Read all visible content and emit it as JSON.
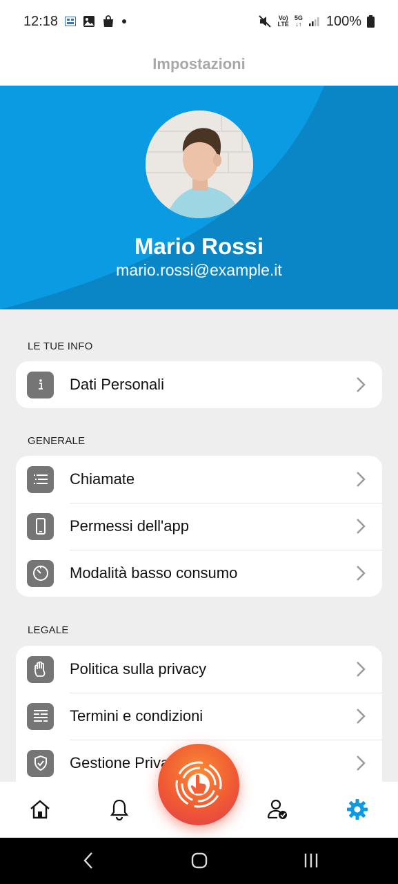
{
  "status_bar": {
    "time": "12:18",
    "battery": "100%",
    "icons": [
      "calendar-notification-icon",
      "image-icon",
      "shopping-bag-icon",
      "dot-icon",
      "mute-icon",
      "volte-icon",
      "5g-icon",
      "signal-icon",
      "battery-icon"
    ],
    "volte_label_top": "Vo)",
    "volte_label_bottom": "LTE",
    "net_label": "5G"
  },
  "header": {
    "title": "Impostazioni"
  },
  "profile": {
    "name": "Mario Rossi",
    "email": "mario.rossi@example.it"
  },
  "sections": [
    {
      "label": "LE TUE INFO",
      "items": [
        {
          "label": "Dati Personali",
          "icon": "info-icon"
        }
      ]
    },
    {
      "label": "GENERALE",
      "items": [
        {
          "label": "Chiamate",
          "icon": "list-icon"
        },
        {
          "label": "Permessi dell'app",
          "icon": "phone-icon"
        },
        {
          "label": "Modalità basso consumo",
          "icon": "timer-icon"
        }
      ]
    },
    {
      "label": "LEGALE",
      "items": [
        {
          "label": "Politica sulla privacy",
          "icon": "hand-icon"
        },
        {
          "label": "Termini e condizioni",
          "icon": "document-icon"
        },
        {
          "label": "Gestione Privacy",
          "icon": "shield-check-icon"
        }
      ]
    }
  ],
  "bottom_nav": {
    "items": [
      "home-icon",
      "bell-icon",
      "sos-touch-icon",
      "user-verified-icon",
      "settings-gear-icon"
    ],
    "active": "settings-gear-icon"
  },
  "colors": {
    "accent": "#0b9be3",
    "accent_dark": "#0a86c7",
    "icon_bg": "#757575",
    "background": "#eeeeee",
    "sos_orange": "#f5773a",
    "sos_red": "#e03a4f"
  }
}
